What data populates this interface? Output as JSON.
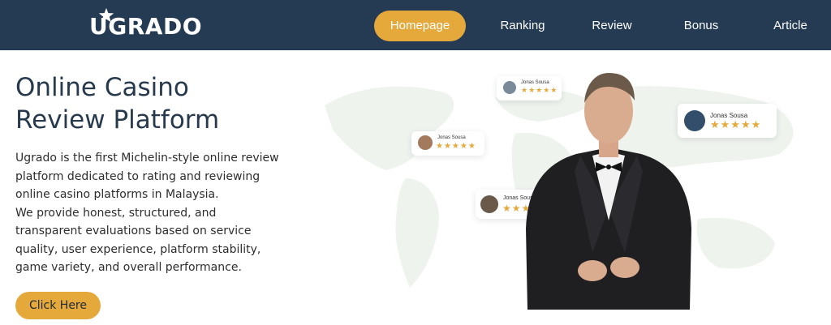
{
  "brand": {
    "name": "UGRADO",
    "accent": "#e5a93b",
    "nav_bg": "#243b53"
  },
  "nav": {
    "items": [
      {
        "label": "Homepage",
        "active": true
      },
      {
        "label": "Ranking",
        "active": false
      },
      {
        "label": "Review",
        "active": false
      },
      {
        "label": "Bonus",
        "active": false
      },
      {
        "label": "Article",
        "active": false
      }
    ]
  },
  "hero": {
    "title_line1": "Online Casino",
    "title_line2": "Review Platform",
    "desc_lines": [
      "Ugrado is the first Michelin-style online review",
      "platform dedicated to rating and reviewing",
      "online casino platforms in Malaysia.",
      "We provide honest, structured, and",
      "transparent evaluations based on service",
      "quality, user experience, platform stability,",
      "game variety, and overall performance."
    ],
    "cta_label": "Click Here"
  },
  "reviews": [
    {
      "name": "Jonas Sousa",
      "stars": "★★★★★"
    },
    {
      "name": "Jonas Sousa",
      "stars": "★★★★★"
    },
    {
      "name": "Jonas Sousa",
      "stars": "★★★★★"
    },
    {
      "name": "Jonas Sousa",
      "stars": "★★★★★"
    }
  ]
}
